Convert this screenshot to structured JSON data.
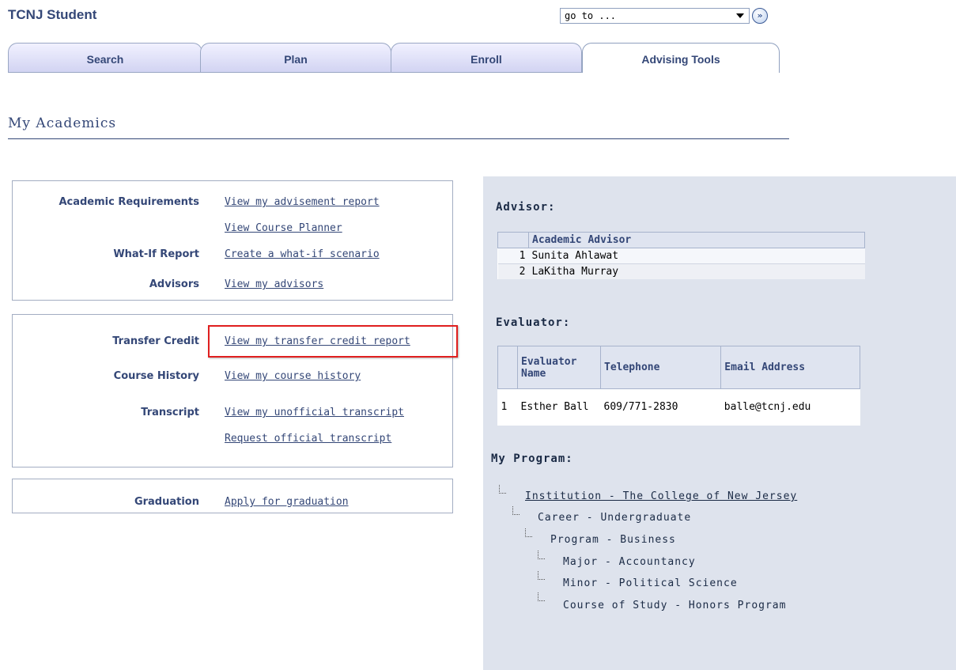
{
  "header": {
    "app_title": "TCNJ Student",
    "goto_value": "go to ...",
    "go_button_icon": "double-chevron-right"
  },
  "tabs": [
    "Search",
    "Plan",
    "Enroll",
    "Advising Tools"
  ],
  "page_title": "My Academics",
  "box1": {
    "rows": [
      {
        "label": "Academic Requirements",
        "link": "View my advisement report"
      },
      {
        "label": "",
        "link": "View Course Planner"
      },
      {
        "label": "What-If Report",
        "link": "Create a what-if scenario"
      },
      {
        "label": "Advisors",
        "link": "View my advisors"
      }
    ]
  },
  "box2": {
    "rows": [
      {
        "label": "Transfer Credit",
        "link": "View my transfer credit report"
      },
      {
        "label": "Course History",
        "link": "View my course history"
      },
      {
        "label": "Transcript",
        "link": "View my unofficial transcript"
      },
      {
        "label": "",
        "link": "Request official transcript"
      }
    ]
  },
  "box3": {
    "rows": [
      {
        "label": "Graduation",
        "link": "Apply for graduation"
      }
    ]
  },
  "advisor": {
    "heading": "Advisor:",
    "column": "Academic Advisor",
    "rows": [
      {
        "num": "1",
        "name": "Sunita Ahlawat"
      },
      {
        "num": "2",
        "name": "LaKitha Murray"
      }
    ]
  },
  "evaluator": {
    "heading": "Evaluator:",
    "columns": [
      "Evaluator Name",
      "Telephone",
      "Email Address"
    ],
    "row": {
      "num": "1",
      "name": "Esther Ball",
      "phone": "609/771-2830",
      "email": "balle@tcnj.edu"
    }
  },
  "program": {
    "heading": "My Program:",
    "items": [
      "Institution - The College of New Jersey",
      "Career - Undergraduate",
      "Program - Business",
      "Major - Accountancy",
      "Minor - Political Science",
      "Course of Study - Honors Program"
    ]
  },
  "colors": {
    "brand": "#344777",
    "highlight": "#e01f1f",
    "panel": "#dee3ed"
  }
}
